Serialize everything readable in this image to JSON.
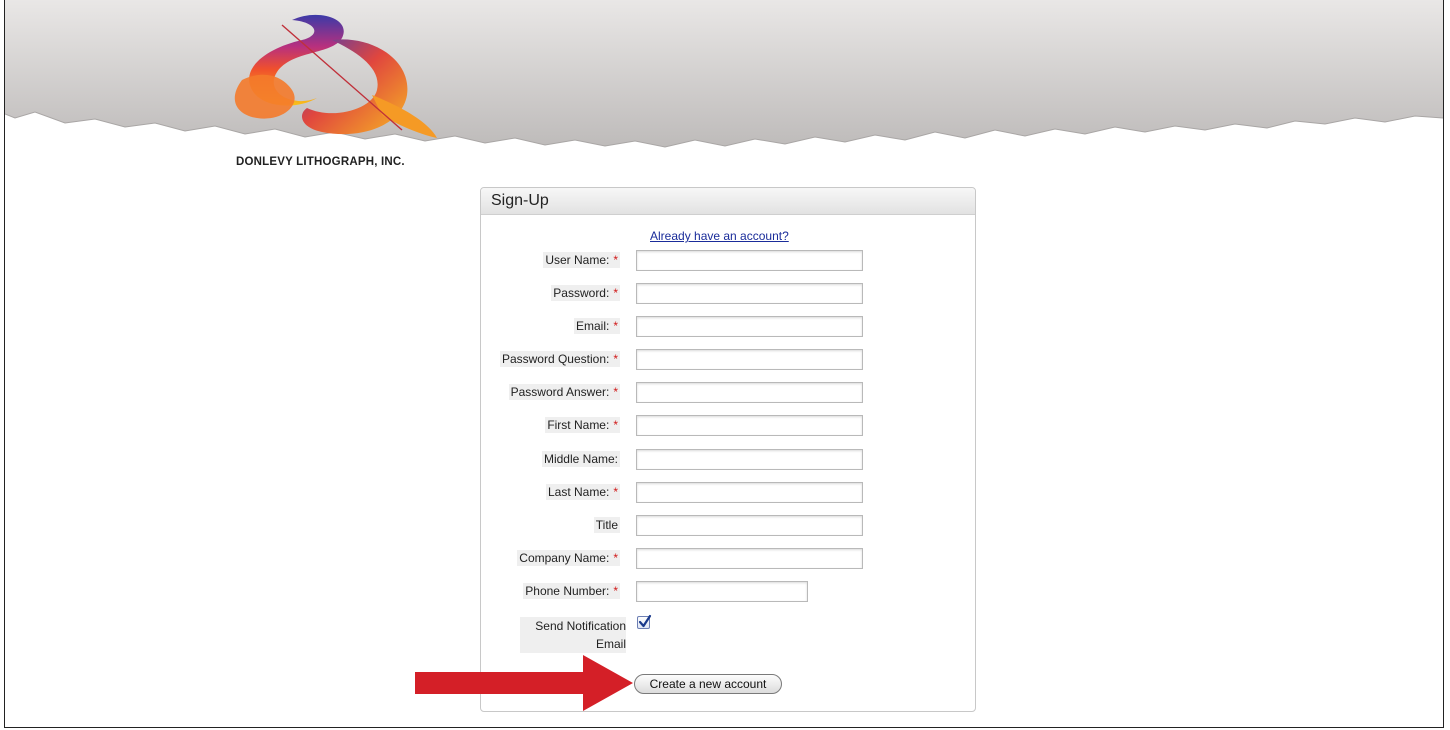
{
  "brand": {
    "company_name": "DONLEVY LITHOGRAPH, INC."
  },
  "panel": {
    "title": "Sign-Up",
    "login_link": "Already have an account?"
  },
  "form": {
    "fields": [
      {
        "label": "User Name:",
        "required": true,
        "value": ""
      },
      {
        "label": "Password:",
        "required": true,
        "value": ""
      },
      {
        "label": "Email:",
        "required": true,
        "value": ""
      },
      {
        "label": "Password Question:",
        "required": true,
        "value": ""
      },
      {
        "label": "Password Answer:",
        "required": true,
        "value": ""
      },
      {
        "label": "First Name:",
        "required": true,
        "value": ""
      },
      {
        "label": "Middle Name:",
        "required": false,
        "value": ""
      },
      {
        "label": "Last Name:",
        "required": true,
        "value": ""
      },
      {
        "label": "Title",
        "required": false,
        "value": ""
      },
      {
        "label": "Company Name:",
        "required": true,
        "value": ""
      },
      {
        "label": "Phone Number:",
        "required": true,
        "value": ""
      }
    ],
    "required_mark": "*",
    "notification": {
      "label_line1": "Send Notification",
      "label_line2": "Email",
      "checked": true
    },
    "submit_label": "Create a new account"
  },
  "icons": {
    "logo": "donlevy-logo-icon",
    "arrow": "red-arrow-icon",
    "checkmark": "checkmark-icon"
  },
  "colors": {
    "required": "#d01818",
    "link": "#1a2c9a",
    "arrow": "#d41f27",
    "banner": "#c9c6c5"
  }
}
